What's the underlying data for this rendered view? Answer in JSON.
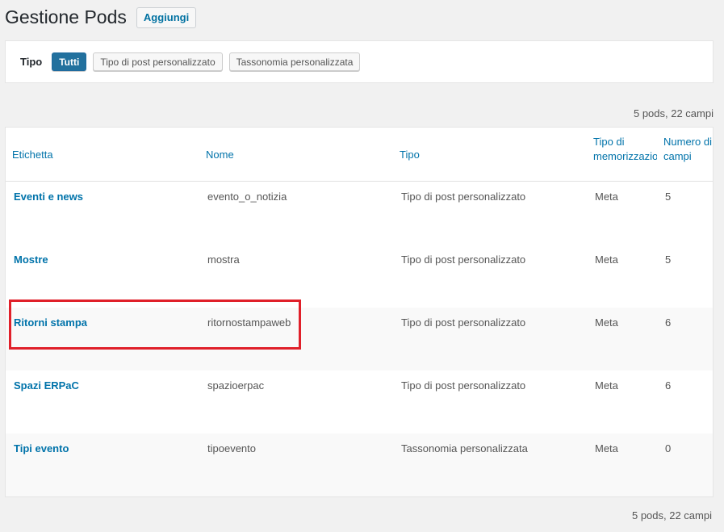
{
  "header": {
    "title": "Gestione Pods",
    "add_label": "Aggiungi"
  },
  "filter": {
    "label": "Tipo",
    "buttons": [
      {
        "label": "Tutti",
        "active": true
      },
      {
        "label": "Tipo di post personalizzato",
        "active": false
      },
      {
        "label": "Tassonomia personalizzata",
        "active": false
      }
    ]
  },
  "counts": {
    "top": "5 pods, 22 campi",
    "bottom": "5 pods, 22 campi"
  },
  "table": {
    "columns": {
      "label": "Etichetta",
      "name": "Nome",
      "type": "Tipo",
      "storage": "Tipo di memorizzazione",
      "fields": "Numero di campi"
    },
    "rows": [
      {
        "label": "Eventi e news",
        "name": "evento_o_notizia",
        "type": "Tipo di post personalizzato",
        "storage": "Meta",
        "fields": "5"
      },
      {
        "label": "Mostre",
        "name": "mostra",
        "type": "Tipo di post personalizzato",
        "storage": "Meta",
        "fields": "5"
      },
      {
        "label": "Ritorni stampa",
        "name": "ritornostampaweb",
        "type": "Tipo di post personalizzato",
        "storage": "Meta",
        "fields": "6"
      },
      {
        "label": "Spazi ERPaC",
        "name": "spazioerpac",
        "type": "Tipo di post personalizzato",
        "storage": "Meta",
        "fields": "6"
      },
      {
        "label": "Tipi evento",
        "name": "tipoevento",
        "type": "Tassonomia personalizzata",
        "storage": "Meta",
        "fields": "0"
      }
    ]
  },
  "colors": {
    "link": "#0073aa",
    "accent": "#22719e",
    "highlight": "#e0202a"
  }
}
